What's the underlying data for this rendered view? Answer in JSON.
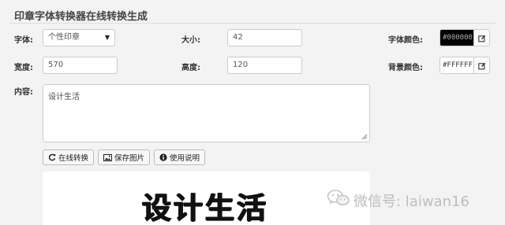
{
  "header": {
    "title": "印章字体转换器在线转换生成"
  },
  "form": {
    "font": {
      "label": "字体:",
      "value": "个性印章"
    },
    "size": {
      "label": "大小:",
      "value": "42"
    },
    "font_color": {
      "label": "字体颜色:",
      "value": "#000000",
      "bg": "#000000",
      "fg": "#aaaaaa"
    },
    "width": {
      "label": "宽度:",
      "value": "570"
    },
    "height": {
      "label": "高度:",
      "value": "120"
    },
    "bg_color": {
      "label": "背景颜色:",
      "value": "#FFFFFF",
      "bg": "#ffffff",
      "fg": "#333333"
    },
    "content": {
      "label": "内容:",
      "value": "设计生活"
    }
  },
  "buttons": {
    "convert": {
      "label": "在线转换",
      "icon": "refresh-icon"
    },
    "save": {
      "label": "保存图片",
      "icon": "image-icon"
    },
    "help": {
      "label": "使用说明",
      "icon": "info-icon"
    }
  },
  "preview": {
    "text": "设计生活"
  },
  "watermark": {
    "text": "微信号: laiwan16",
    "icon": "wechat-icon"
  }
}
